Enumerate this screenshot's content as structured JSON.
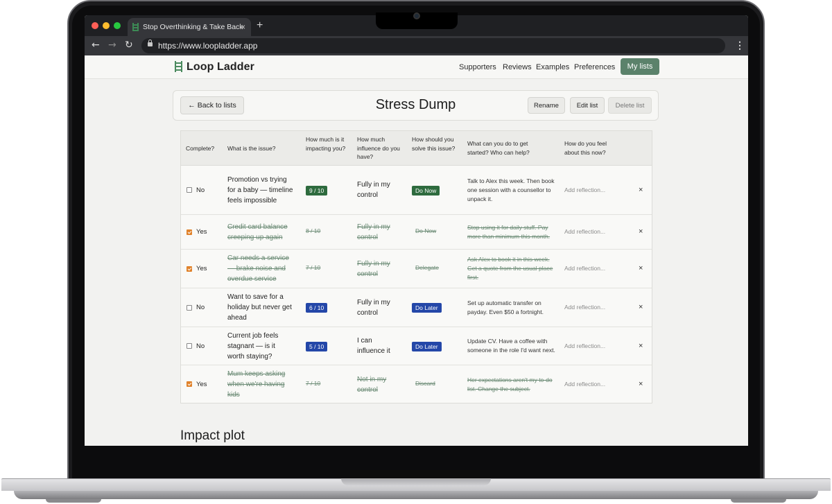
{
  "browser": {
    "tab_title": "Stop Overthinking & Take Back",
    "tab_close": "×",
    "new_tab": "+",
    "url": "https://www.loopladder.app"
  },
  "site": {
    "brand": "Loop Ladder",
    "nav": [
      "Supporters",
      "Reviews",
      "Examples",
      "Preferences"
    ],
    "cta": "My lists"
  },
  "list": {
    "back": "← Back to lists",
    "title": "Stress Dump",
    "rename": "Rename",
    "edit": "Edit list",
    "delete": "Delete list"
  },
  "table": {
    "headers": {
      "complete": "Complete?",
      "issue": "What is the issue?",
      "impact": "How much is it impacting you?",
      "influence": "How much influence do you have?",
      "solve": "How should you solve this issue?",
      "start": "What can you do to get started? Who can help?",
      "feel": "How do you feel about this now?"
    },
    "rows": [
      {
        "complete": "No",
        "checked": false,
        "issue": "Promotion vs trying for a baby — timeline feels impossible",
        "impact": "9 / 10",
        "influence": "Fully in my control",
        "solve": "Do Now",
        "start": "Talk to Alex this week. Then book one session with a counsellor to unpack it.",
        "reflection": "Add reflection...",
        "delete": "×"
      },
      {
        "complete": "Yes",
        "checked": true,
        "issue": "Credit card balance creeping up again",
        "impact": "8 / 10",
        "influence": "Fully in my control",
        "solve": "Do Now",
        "start": "Stop using it for daily stuff. Pay more than minimum this month.",
        "reflection": "Add reflection...",
        "delete": "×"
      },
      {
        "complete": "Yes",
        "checked": true,
        "issue": "Car needs a service — brake noise and overdue service",
        "impact": "7 / 10",
        "influence": "Fully in my control",
        "solve": "Delegate",
        "start": "Ask Alex to book it in this week. Get a quote from the usual place first.",
        "reflection": "Add reflection...",
        "delete": "×"
      },
      {
        "complete": "No",
        "checked": false,
        "issue": "Want to save for a holiday but never get ahead",
        "impact": "6 / 10",
        "influence": "Fully in my control",
        "solve": "Do Later",
        "start": "Set up automatic transfer on payday. Even $50 a fortnight.",
        "reflection": "Add reflection...",
        "delete": "×"
      },
      {
        "complete": "No",
        "checked": false,
        "issue": "Current job feels stagnant — is it worth staying?",
        "impact": "5 / 10",
        "influence": "I can influence it",
        "solve": "Do Later",
        "start": "Update CV. Have a coffee with someone in the role I'd want next.",
        "reflection": "Add reflection...",
        "delete": "×"
      },
      {
        "complete": "Yes",
        "checked": true,
        "issue": "Mum keeps asking when we're having kids",
        "impact": "7 / 10",
        "influence": "Not in my control",
        "solve": "Discard",
        "start": "Her expectations aren't my to-do list. Change the subject.",
        "reflection": "Add reflection...",
        "delete": "×"
      }
    ]
  },
  "impact_plot": {
    "title": "Impact plot"
  },
  "colors": {
    "brand_green": "#5b826b",
    "badge_green": "#2e6b3e",
    "badge_blue": "#2447a8",
    "checkbox_orange": "#e0822b"
  }
}
